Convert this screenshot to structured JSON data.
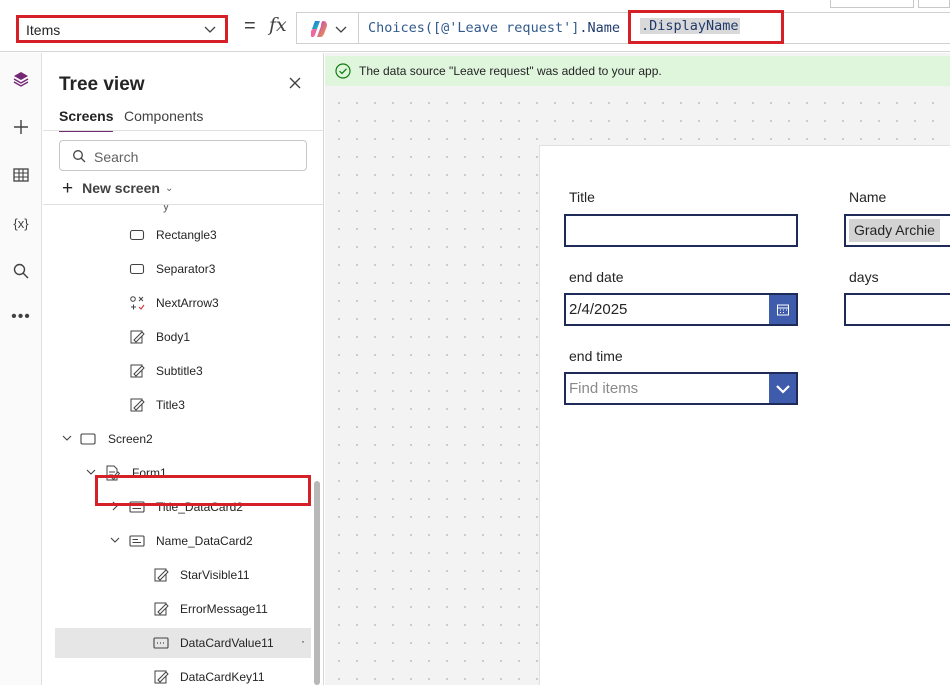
{
  "formula_bar": {
    "property_value": "Items",
    "equals": "=",
    "fx_label": "fx",
    "formula_prefix_fn": "Choices(",
    "formula_prefix_arg": "[@'Leave request']",
    "formula_prefix_rest": ".Name",
    "formula_highlight": ".DisplayName"
  },
  "left_rail": {
    "icons": [
      "tree-view-icon",
      "insert-icon",
      "data-icon",
      "variables-icon",
      "search-icon",
      "more-icon"
    ]
  },
  "tree_view": {
    "title": "Tree view",
    "tabs": [
      "Screens",
      "Components"
    ],
    "search_placeholder": "Search",
    "new_screen_label": "New screen",
    "items": [
      {
        "label": "Rectangle3",
        "icon": "rectangle-icon"
      },
      {
        "label": "Separator3",
        "icon": "rectangle-icon"
      },
      {
        "label": "NextArrow3",
        "icon": "icon-control-icon"
      },
      {
        "label": "Body1",
        "icon": "text-label-icon"
      },
      {
        "label": "Subtitle3",
        "icon": "text-label-icon"
      },
      {
        "label": "Title3",
        "icon": "text-label-icon"
      },
      {
        "label": "Screen2",
        "icon": "screen-icon"
      },
      {
        "label": "Form1",
        "icon": "form-icon"
      },
      {
        "label": "Title_DataCard2",
        "icon": "datacard-icon"
      },
      {
        "label": "Name_DataCard2",
        "icon": "datacard-icon"
      },
      {
        "label": "StarVisible11",
        "icon": "text-label-icon"
      },
      {
        "label": "ErrorMessage11",
        "icon": "text-label-icon"
      },
      {
        "label": "DataCardValue11",
        "icon": "combobox-icon"
      },
      {
        "label": "DataCardKey11",
        "icon": "text-label-icon"
      }
    ]
  },
  "notification": {
    "message": "The data source \"Leave request\" was added to your app."
  },
  "form": {
    "title_label": "Title",
    "title_value": "",
    "name_label": "Name",
    "name_value": "Grady Archie",
    "end_date_label": "end date",
    "end_date_value": "2/4/2025",
    "days_label": "days",
    "days_value": "",
    "end_time_label": "end time",
    "end_time_placeholder": "Find items"
  },
  "colors": {
    "accent_purple": "#742774",
    "highlight_red": "#d62027",
    "form_border": "#1e2a58",
    "button_blue": "#3f5bab",
    "notification_bg": "#dff6dd",
    "success_green": "#107c10"
  }
}
